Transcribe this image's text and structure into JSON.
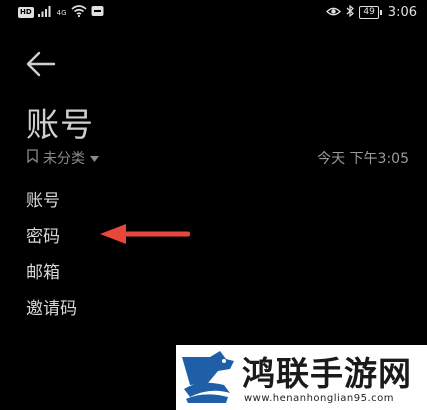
{
  "status_bar": {
    "hd_badge": "HD",
    "network_label": "4G",
    "battery_level": "49",
    "time": "3:06"
  },
  "header": {
    "title": "账号"
  },
  "meta": {
    "category": "未分类",
    "timestamp": "今天 下午3:05"
  },
  "fields": [
    {
      "label": "账号"
    },
    {
      "label": "密码"
    },
    {
      "label": "邮箱"
    },
    {
      "label": "邀请码"
    }
  ],
  "watermark": {
    "title": "鸿联手游网",
    "url": "www.henanhonglian95.com"
  },
  "colors": {
    "background": "#000000",
    "arrow": "#e8473c",
    "text": "#d8d8d8"
  },
  "icons": {
    "back": "arrow-left-icon",
    "category": "bookmark-icon",
    "dropdown": "caret-down-icon"
  }
}
